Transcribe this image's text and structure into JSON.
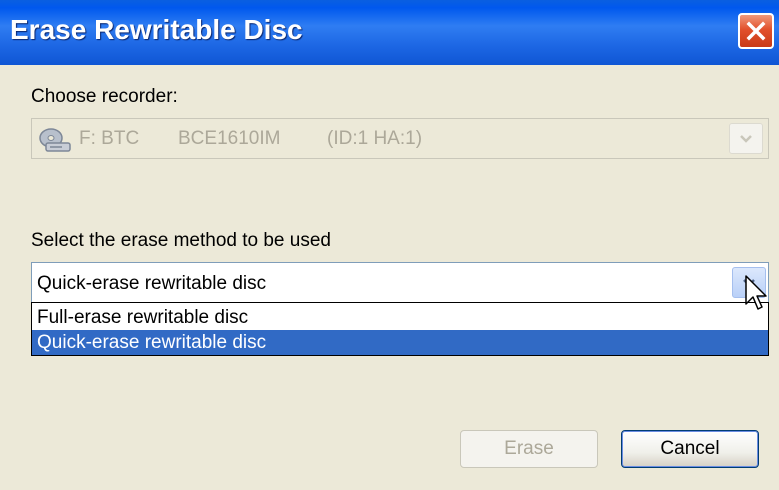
{
  "window": {
    "title": "Erase Rewritable Disc",
    "close_icon": "close-icon"
  },
  "recorder": {
    "label": "Choose recorder:",
    "icon": "cd-drive-icon",
    "drive": "F: BTC",
    "model": "BCE1610IM",
    "id": "(ID:1 HA:1)",
    "enabled": false
  },
  "erase_method": {
    "label": "Select the erase method to be used",
    "selected": "Quick-erase rewritable disc",
    "options": [
      "Full-erase rewritable disc",
      "Quick-erase rewritable disc"
    ],
    "highlighted_index": 1,
    "dropdown_open": true
  },
  "buttons": {
    "erase": "Erase",
    "cancel": "Cancel"
  },
  "colors": {
    "titlebar": "#0058ee",
    "dialog_bg": "#ece9d8",
    "selection": "#316ac5",
    "close_button": "#e2512c"
  }
}
